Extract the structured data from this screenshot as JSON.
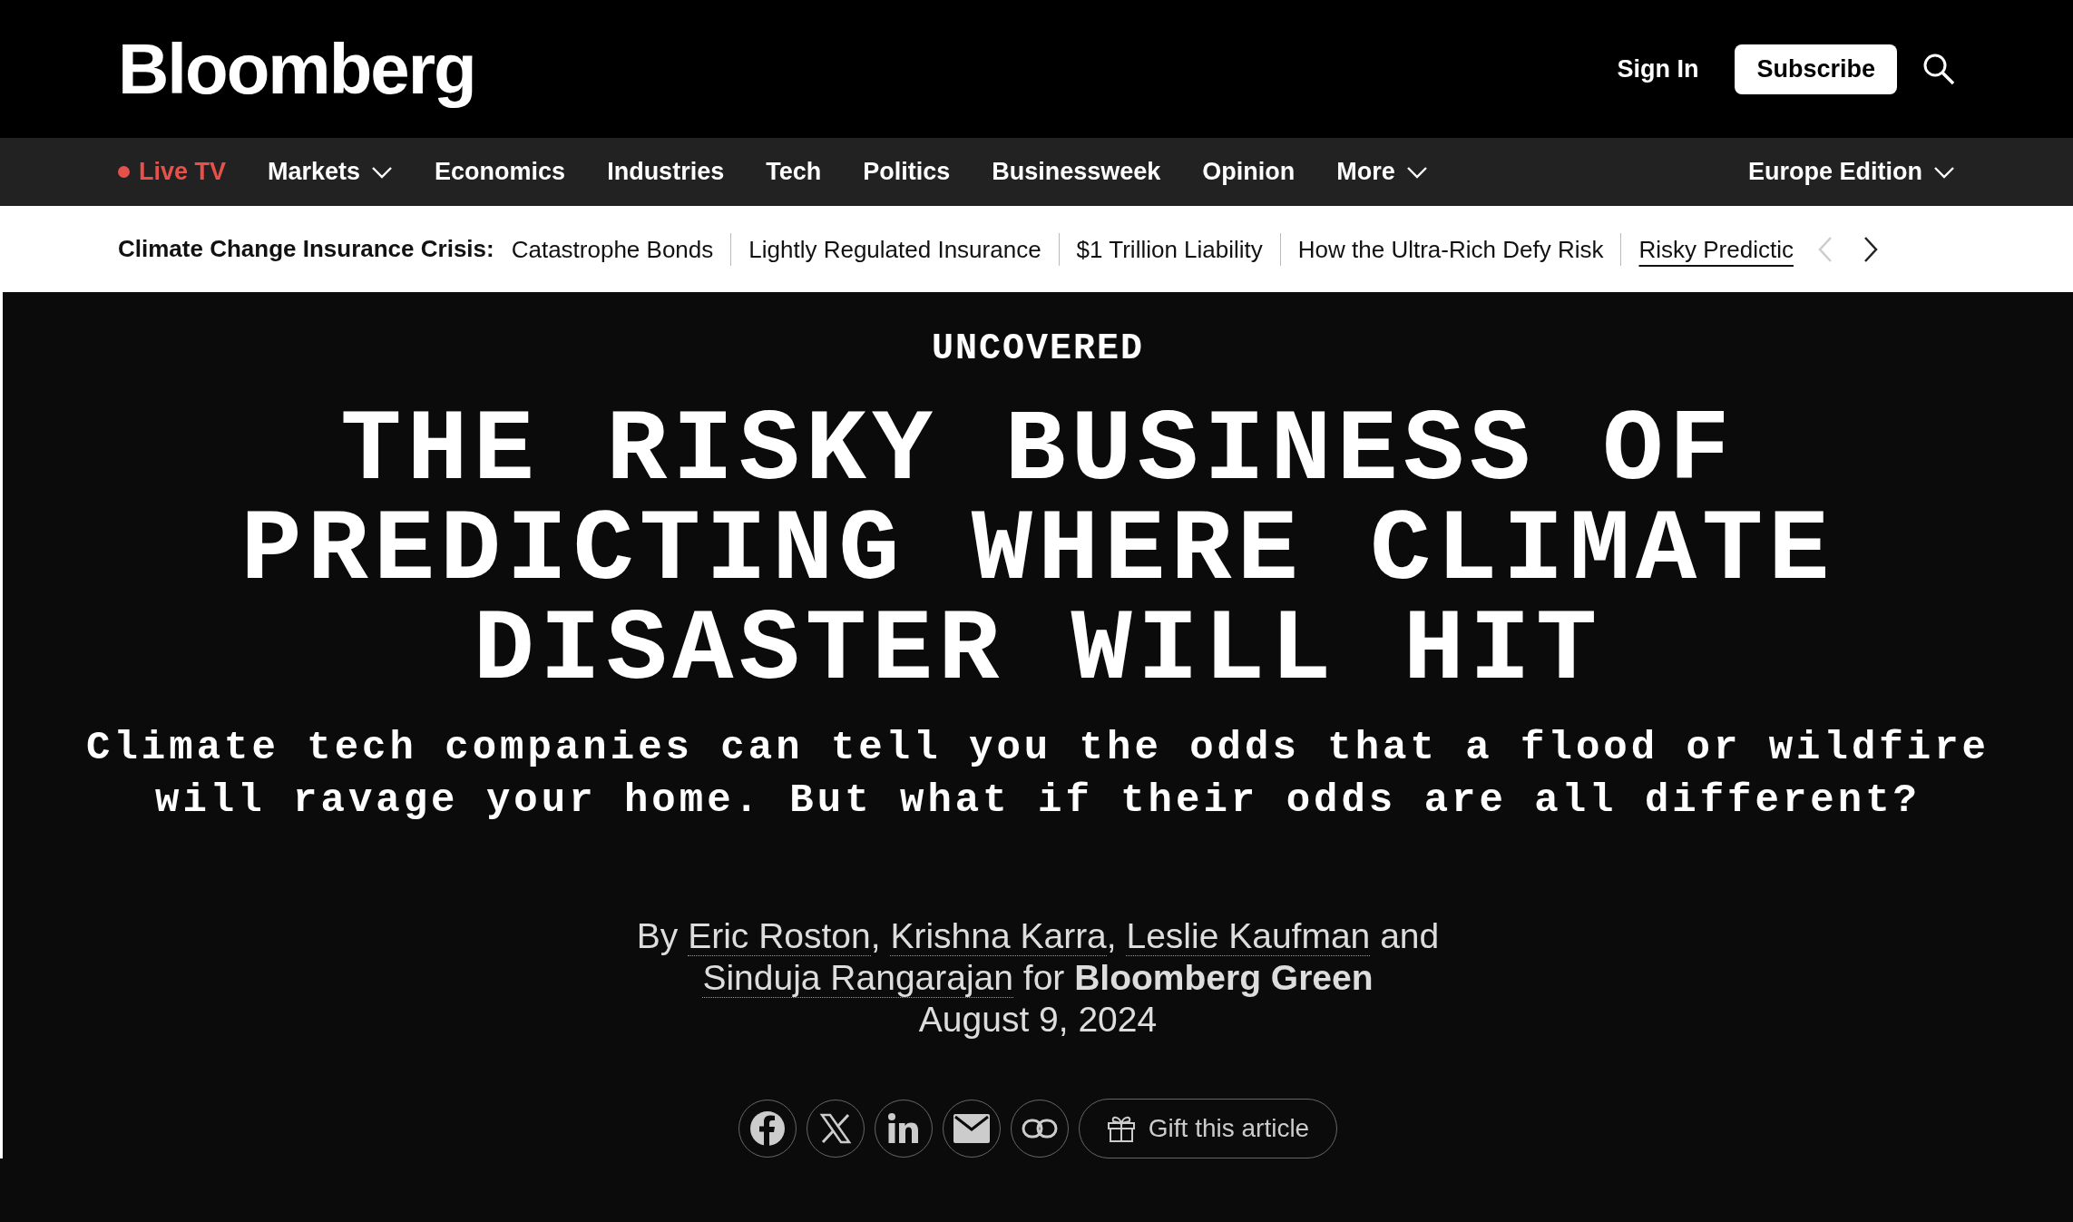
{
  "header": {
    "logo": "Bloomberg",
    "sign_in": "Sign In",
    "subscribe": "Subscribe"
  },
  "nav": {
    "items": [
      {
        "label": "Live TV",
        "kind": "live",
        "has_menu": false
      },
      {
        "label": "Markets",
        "kind": "link",
        "has_menu": true
      },
      {
        "label": "Economics",
        "kind": "link",
        "has_menu": false
      },
      {
        "label": "Industries",
        "kind": "link",
        "has_menu": false
      },
      {
        "label": "Tech",
        "kind": "link",
        "has_menu": false
      },
      {
        "label": "Politics",
        "kind": "link",
        "has_menu": false
      },
      {
        "label": "Businessweek",
        "kind": "link",
        "has_menu": false
      },
      {
        "label": "Opinion",
        "kind": "link",
        "has_menu": false
      },
      {
        "label": "More",
        "kind": "link",
        "has_menu": true
      }
    ],
    "edition": {
      "label": "Europe Edition",
      "has_menu": true
    }
  },
  "topics": {
    "label": "Climate Change Insurance Crisis:",
    "items": [
      {
        "label": "Catastrophe Bonds",
        "selected": false
      },
      {
        "label": "Lightly Regulated Insurance",
        "selected": false
      },
      {
        "label": "$1 Trillion Liability",
        "selected": false
      },
      {
        "label": "How the Ultra-Rich Defy Risk",
        "selected": false
      },
      {
        "label": "Risky Predictic",
        "selected": true
      }
    ],
    "prev_disabled": true,
    "next_disabled": false
  },
  "article": {
    "kicker": "UNCOVERED",
    "headline": [
      "THE RISKY BUSINESS OF",
      "PREDICTING WHERE CLIMATE",
      "DISASTER WILL HIT"
    ],
    "dek": [
      "Climate tech companies can tell you the odds that a flood or wildfire",
      "will ravage your home. But what if their odds are all different?"
    ],
    "byline": [
      [
        {
          "kind": "text",
          "text": "By "
        },
        {
          "kind": "link",
          "text": "Eric Roston"
        },
        {
          "kind": "text",
          "text": ", "
        },
        {
          "kind": "link",
          "text": "Krishna Karra"
        },
        {
          "kind": "text",
          "text": ", "
        },
        {
          "kind": "link",
          "text": "Leslie Kaufman"
        },
        {
          "kind": "text",
          "text": " and"
        }
      ],
      [
        {
          "kind": "link",
          "text": "Sinduja Rangarajan"
        },
        {
          "kind": "text",
          "text": " for "
        },
        {
          "kind": "bold",
          "text": "Bloomberg Green"
        }
      ]
    ],
    "date": "August 9, 2024",
    "share": [
      {
        "kind": "facebook"
      },
      {
        "kind": "x"
      },
      {
        "kind": "linkedin"
      },
      {
        "kind": "email"
      },
      {
        "kind": "link"
      }
    ],
    "gift": "Gift this article"
  }
}
